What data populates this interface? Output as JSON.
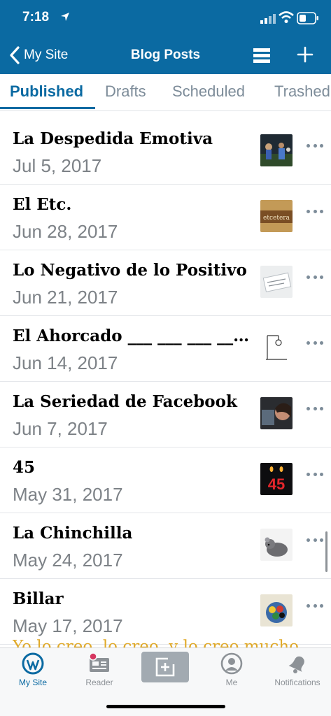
{
  "status_bar": {
    "time": "7:18"
  },
  "nav": {
    "back_label": "My Site",
    "title": "Blog Posts"
  },
  "tabs": [
    "Published",
    "Drafts",
    "Scheduled",
    "Trashed"
  ],
  "posts": [
    {
      "title": "La Despedida Emotiva",
      "date": "Jul 5, 2017",
      "thumb": "party-photo"
    },
    {
      "title": "El Etc.",
      "date": "Jun 28, 2017",
      "thumb": "etcetera-sign"
    },
    {
      "title": "Lo Negativo de lo Positivo",
      "date": "Jun 21, 2017",
      "thumb": "paper-notes"
    },
    {
      "title": "El Ahorcado ___ ___ ___ ___ ___",
      "date": "Jun 14, 2017",
      "thumb": "hangman-drawing"
    },
    {
      "title": "La Seriedad de Facebook",
      "date": "Jun 7, 2017",
      "thumb": "person-at-laptop"
    },
    {
      "title": "45",
      "date": "May 31, 2017",
      "thumb": "45-candles"
    },
    {
      "title": "La Chinchilla",
      "date": "May 24, 2017",
      "thumb": "chinchilla"
    },
    {
      "title": "Billar",
      "date": "May 17, 2017",
      "thumb": "billiard-balls"
    }
  ],
  "next_post_peek": "Yo lo creo, lo creo, y lo creo mucho",
  "tab_bar": [
    {
      "label": "My Site",
      "icon": "wordpress-icon"
    },
    {
      "label": "Reader",
      "icon": "reader-icon"
    },
    {
      "label": "",
      "icon": "new-post-icon"
    },
    {
      "label": "Me",
      "icon": "me-icon"
    },
    {
      "label": "Notifications",
      "icon": "bell-icon"
    }
  ],
  "colors": {
    "brand": "#0b6aa2",
    "muted": "#7d8c99",
    "accent": "#e0a928",
    "badge": "#d63660"
  }
}
